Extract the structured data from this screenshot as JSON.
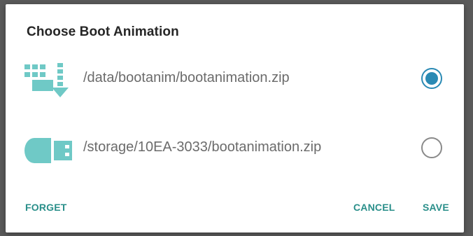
{
  "dialog": {
    "title": "Choose Boot Animation",
    "options": [
      {
        "icon": "internal-storage-download-icon",
        "path": "/data/bootanim/bootanimation.zip",
        "selected": true
      },
      {
        "icon": "usb-drive-icon",
        "path": "/storage/10EA-3033/bootanimation.zip",
        "selected": false
      }
    ],
    "actions": {
      "forget": "FORGET",
      "cancel": "CANCEL",
      "save": "SAVE"
    }
  },
  "colors": {
    "accent": "#2a8f8a",
    "radio_selected": "#2a8ab4",
    "icon": "#6fc9c6"
  }
}
